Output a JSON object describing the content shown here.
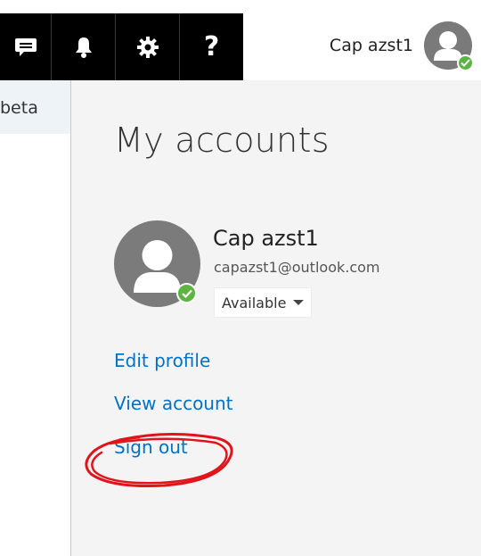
{
  "toolbar": {
    "items": [
      {
        "icon": "chat-icon"
      },
      {
        "icon": "bell-icon"
      },
      {
        "icon": "gear-icon"
      },
      {
        "icon": "help-icon",
        "label": "?"
      }
    ]
  },
  "header": {
    "user_name": "Cap azst1"
  },
  "left_nav": {
    "item_label": "beta"
  },
  "panel": {
    "title": "My accounts",
    "account": {
      "name": "Cap azst1",
      "email": "capazst1@outlook.com",
      "status": "Available"
    },
    "links": {
      "edit_profile": "Edit profile",
      "view_account": "View account",
      "sign_out": "Sign out"
    }
  },
  "colors": {
    "link": "#0072c6",
    "status_available": "#5db443",
    "annotation": "#e0141b",
    "toolbar_bg": "#000000"
  }
}
